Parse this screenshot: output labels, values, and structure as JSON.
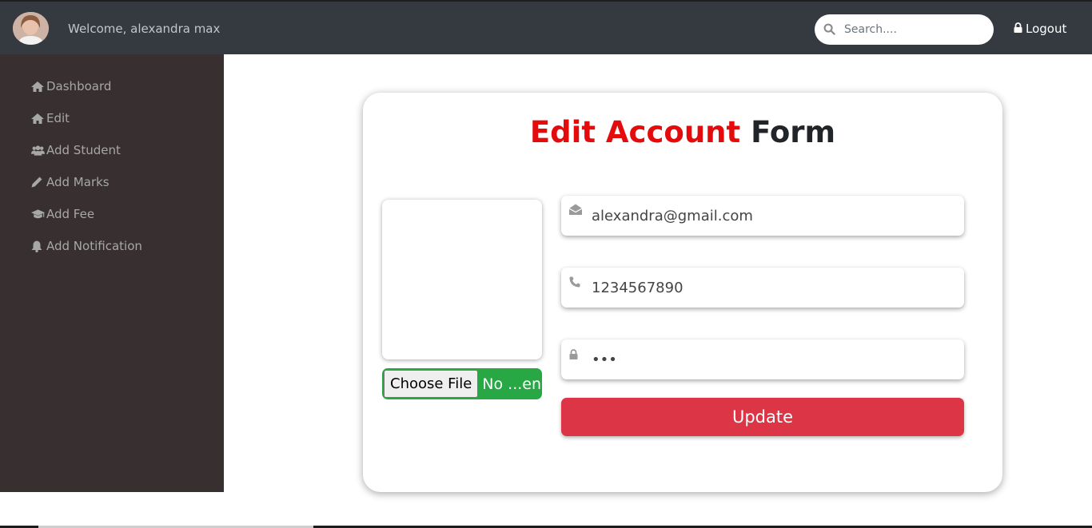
{
  "header": {
    "welcome_text": "Welcome, alexandra max",
    "search_placeholder": "Search....",
    "logout_label": "Logout"
  },
  "sidebar": {
    "items": [
      {
        "label": "Dashboard",
        "icon": "home-icon"
      },
      {
        "label": "Edit",
        "icon": "home-icon"
      },
      {
        "label": "Add Student",
        "icon": "users-icon"
      },
      {
        "label": "Add Marks",
        "icon": "pencil-icon"
      },
      {
        "label": "Add Fee",
        "icon": "graduation-cap-icon"
      },
      {
        "label": "Add Notification",
        "icon": "bell-icon"
      }
    ]
  },
  "form": {
    "title_accent": "Edit Account",
    "title_rest": "Form",
    "email_value": "alexandra@gmail.com",
    "phone_value": "1234567890",
    "password_value": "...",
    "file_button_label": "Choose File",
    "file_status": "No ...en",
    "update_label": "Update"
  },
  "colors": {
    "topbar": "#343a40",
    "sidebar": "#383030",
    "title_accent": "#e30b0b",
    "file_input_bg": "#28a745",
    "update_button": "#dc3545"
  }
}
